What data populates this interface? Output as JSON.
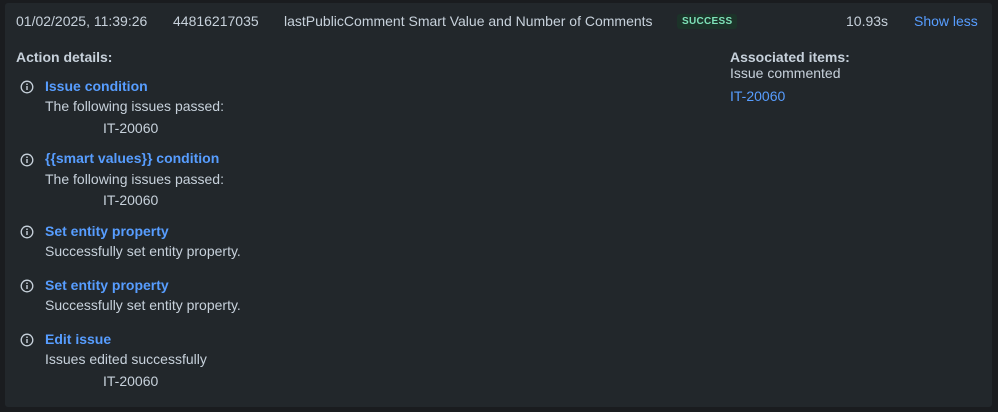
{
  "execution": {
    "date": "01/02/2025, 11:39:26",
    "id": "44816217035",
    "rule_name": "lastPublicComment Smart Value and Number of Comments",
    "status": "SUCCESS",
    "duration": "10.93s",
    "toggle_label": "Show less"
  },
  "colors": {
    "panel_bg": "#22272b",
    "link": "#579dff",
    "success_text": "#7ee2b8",
    "success_bg": "#1c3329"
  },
  "action_details": {
    "heading": "Action details:",
    "items": [
      {
        "icon": "info-icon",
        "title": "Issue condition",
        "description": "The following issues passed:",
        "issue": "IT-20060"
      },
      {
        "icon": "info-icon",
        "title": "{{smart values}} condition",
        "description": "The following issues passed:",
        "issue": "IT-20060"
      },
      {
        "icon": "info-icon",
        "title": "Set entity property",
        "description": "Successfully set entity property."
      },
      {
        "icon": "info-icon",
        "title": "Set entity property",
        "description": "Successfully set entity property."
      },
      {
        "icon": "info-icon",
        "title": "Edit issue",
        "description": "Issues edited successfully",
        "issue": "IT-20060"
      }
    ]
  },
  "associated_items": {
    "heading": "Associated items:",
    "subheading": "Issue commented",
    "issue": "IT-20060"
  }
}
